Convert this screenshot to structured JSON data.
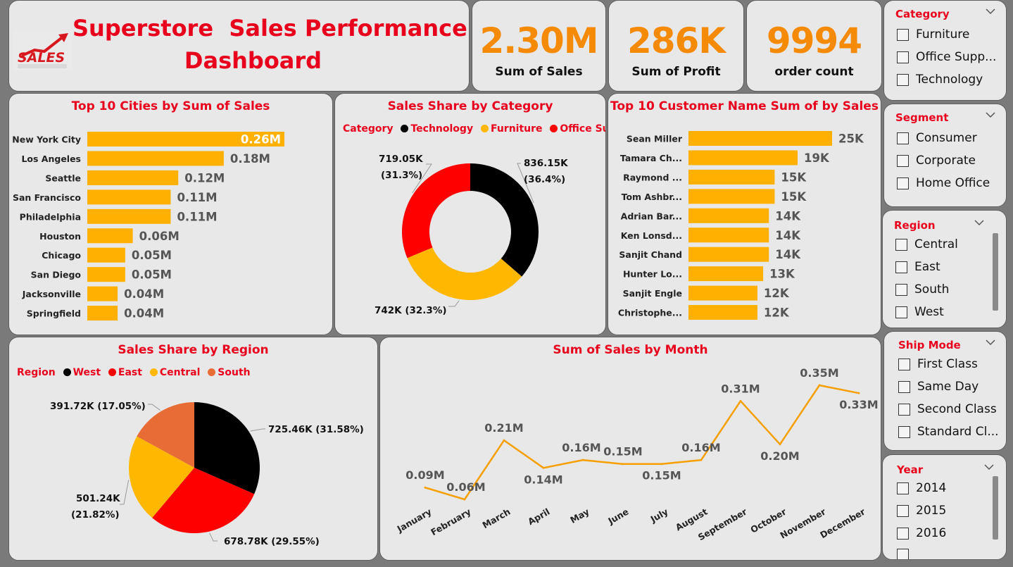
{
  "header": {
    "title_line1": "Superstore  Sales Performance",
    "title_line2": "Dashboard",
    "logo_text": "SALES"
  },
  "kpis": [
    {
      "value": "2.30M",
      "label": "Sum of Sales"
    },
    {
      "value": "286K",
      "label": "Sum of Profit"
    },
    {
      "value": "9994",
      "label": "order count"
    }
  ],
  "colors": {
    "accent_red": "#e8001c",
    "kpi_orange": "#f58a07",
    "bar_orange": "#ffb000",
    "line_orange": "#f5a000",
    "technology": "#000000",
    "furniture": "#ffb700",
    "office_supplies": "#ff0000",
    "west": "#000000",
    "east": "#ff0000",
    "central": "#ffb700",
    "south": "#e76c36"
  },
  "slicers": [
    {
      "title": "Category",
      "items": [
        "Furniture",
        "Office Supp...",
        "Technology"
      ]
    },
    {
      "title": "Segment",
      "items": [
        "Consumer",
        "Corporate",
        "Home Office"
      ]
    },
    {
      "title": "Region",
      "items": [
        "Central",
        "East",
        "South",
        "West"
      ]
    },
    {
      "title": "Ship Mode",
      "items": [
        "First Class",
        "Same Day",
        "Second Class",
        "Standard Cl..."
      ]
    },
    {
      "title": "Year",
      "items": [
        "2014",
        "2015",
        "2016"
      ]
    }
  ],
  "chart_data": [
    {
      "type": "bar",
      "title": "Top 10 Cities by Sum of Sales",
      "categories": [
        "New York City",
        "Los Angeles",
        "Seattle",
        "San Francisco",
        "Philadelphia",
        "Houston",
        "Chicago",
        "San Diego",
        "Jacksonville",
        "Springfield"
      ],
      "values": [
        0.26,
        0.18,
        0.12,
        0.11,
        0.11,
        0.06,
        0.05,
        0.05,
        0.04,
        0.04
      ],
      "labels": [
        "0.26M",
        "0.18M",
        "0.12M",
        "0.11M",
        "0.11M",
        "0.06M",
        "0.05M",
        "0.05M",
        "0.04M",
        "0.04M"
      ],
      "orientation": "horizontal"
    },
    {
      "type": "pie",
      "variant": "donut",
      "title": "Sales Share by Category",
      "legend_title": "Category",
      "legend_position": "top-left",
      "slices": [
        {
          "name": "Technology",
          "value": 836.15,
          "label_value": "836.15K",
          "label_pct": "(36.4%)"
        },
        {
          "name": "Furniture",
          "value": 742,
          "label_value": "742K",
          "label_pct": "(32.3%)"
        },
        {
          "name": "Office Sup...",
          "value": 719.05,
          "label_value": "719.05K",
          "label_pct": "(31.3%)"
        }
      ]
    },
    {
      "type": "bar",
      "title": "Top 10 Customer Name Sum of by Sales",
      "categories": [
        "Sean Miller",
        "Tamara Ch...",
        "Raymond ...",
        "Tom Ashbr...",
        "Adrian Bar...",
        "Ken Lonsd...",
        "Sanjit Chand",
        "Hunter Lo...",
        "Sanjit Engle",
        "Christophe..."
      ],
      "values": [
        25,
        19,
        15,
        15,
        14,
        14,
        14,
        13,
        12,
        12
      ],
      "labels": [
        "25K",
        "19K",
        "15K",
        "15K",
        "14K",
        "14K",
        "14K",
        "13K",
        "12K",
        "12K"
      ],
      "orientation": "horizontal"
    },
    {
      "type": "pie",
      "title": "Sales Share by Region",
      "legend_title": "Region",
      "legend_position": "top-left",
      "slices": [
        {
          "name": "West",
          "value": 725.46,
          "label": "725.46K (31.58%)"
        },
        {
          "name": "East",
          "value": 678.78,
          "label": "678.78K (29.55%)"
        },
        {
          "name": "Central",
          "value": 501.24,
          "label_value": "501.24K",
          "label_pct": "(21.82%)"
        },
        {
          "name": "South",
          "value": 391.72,
          "label": "391.72K (17.05%)"
        }
      ]
    },
    {
      "type": "line",
      "title": "Sum of Sales by Month",
      "categories": [
        "January",
        "February",
        "March",
        "April",
        "May",
        "June",
        "July",
        "August",
        "September",
        "October",
        "November",
        "December"
      ],
      "values": [
        0.09,
        0.06,
        0.21,
        0.14,
        0.16,
        0.15,
        0.15,
        0.16,
        0.31,
        0.2,
        0.35,
        0.33
      ],
      "labels": [
        "0.09M",
        "0.06M",
        "0.21M",
        "0.14M",
        "0.16M",
        "0.15M",
        "0.15M",
        "0.16M",
        "0.31M",
        "0.20M",
        "0.35M",
        "0.33M"
      ]
    }
  ]
}
